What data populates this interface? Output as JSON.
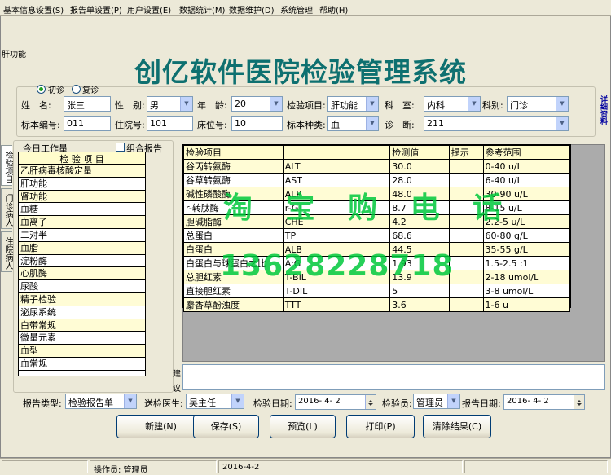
{
  "menu": [
    "基本信息设置(S)",
    "报告单设置(P)",
    "用户设置(E)",
    "数据统计(M)",
    "数据维护(D)",
    "系统管理",
    "帮助(H)"
  ],
  "window": {
    "section_label": "肝功能",
    "app_title": "创亿软件医院检验管理系统",
    "side_link": "详细资料"
  },
  "patient": {
    "radio_first": "初诊",
    "radio_revisit": "复诊",
    "name_label": "姓　名:",
    "name_value": "张三",
    "gender_label": "性　别:",
    "gender_value": "男",
    "age_label": "年　龄:",
    "age_value": "20",
    "test_item_label": "检验项目:",
    "test_item_value": "肝功能",
    "dept_label": "科　室:",
    "dept_value": "内科",
    "category_label": "科别:",
    "category_value": "门诊",
    "specimen_no_label": "标本编号:",
    "specimen_no_value": "011",
    "admission_no_label": "住院号:",
    "admission_no_value": "101",
    "bed_no_label": "床位号:",
    "bed_no_value": "10",
    "specimen_type_label": "标本种类:",
    "specimen_type_value": "血",
    "diagnosis_label": "诊　断:",
    "diagnosis_value": "211"
  },
  "vertical_tabs": [
    "检验项目",
    "门诊病人",
    "住院病人"
  ],
  "worklist": {
    "title": "今日工作量",
    "combo_label": "组合报告",
    "header": "检 验 项 目",
    "items": [
      "乙肝病毒核酸定量",
      "肝功能",
      "肾功能",
      "血糖",
      "血离子",
      "二对半",
      "血脂",
      "淀粉酶",
      "心肌酶",
      "尿酸",
      "精子检验",
      "泌尿系统",
      "白带常规",
      "微量元素",
      "血型",
      "血常规"
    ]
  },
  "results": {
    "headers": [
      "检验项目",
      "",
      "检测值",
      "提示",
      "参考范围"
    ],
    "rows": [
      [
        "谷丙转氨酶",
        "ALT",
        "30.0",
        "",
        "0-40 u/L"
      ],
      [
        "谷草转氨酶",
        "AST",
        "28.0",
        "",
        "6-40 u/L"
      ],
      [
        "碱性磷酸酶",
        "ALP",
        "48.0",
        "",
        "30-90 u/L"
      ],
      [
        "r-转肽酶",
        "r-GT",
        "8.7",
        "",
        "8-15 u/L"
      ],
      [
        "胆碱脂酶",
        "CHE",
        "4.2",
        "",
        "2.2-5 u/L"
      ],
      [
        "总蛋白",
        "TP",
        "68.6",
        "",
        "60-80 g/L"
      ],
      [
        "白蛋白",
        "ALB",
        "44.5",
        "",
        "35-55 g/L"
      ],
      [
        "白蛋白与球蛋白之比",
        "A:G",
        "1.93",
        "",
        "1.5-2.5 :1"
      ],
      [
        "总胆红素",
        "T-BIL",
        "13.9",
        "",
        "2-18 umol/L"
      ],
      [
        "直接胆红素",
        "T-DIL",
        "5",
        "",
        "3-8 umol/L"
      ],
      [
        "麝香草酚浊度",
        "TTT",
        "3.6",
        "",
        "1-6 u"
      ]
    ]
  },
  "advice_label_1": "建",
  "advice_label_2": "议",
  "footer": {
    "report_type_label": "报告类型:",
    "report_type_value": "检验报告单",
    "sender_label": "送检医生:",
    "sender_value": "吴主任",
    "test_date_label": "检验日期:",
    "test_date_value": "2016- 4- 2",
    "tester_label": "检验员:",
    "tester_value": "管理员",
    "report_date_label": "报告日期:",
    "report_date_value": "2016- 4- 2"
  },
  "buttons": [
    "新建(N)",
    "保存(S)",
    "预览(L)",
    "打印(P)",
    "清除结果(C)"
  ],
  "status": {
    "operator": "操作员: 管理员",
    "date": "2016-4-2"
  },
  "watermark": {
    "line1": "淘 宝 购 电 话",
    "line2": "13628228718"
  }
}
